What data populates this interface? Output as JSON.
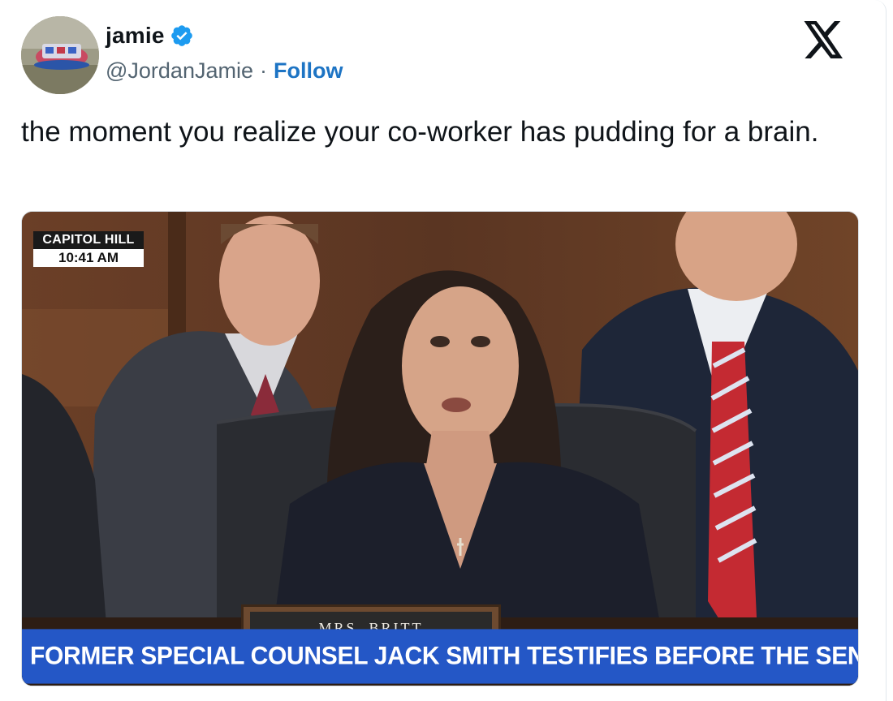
{
  "author": {
    "name": "jamie",
    "handle": "@JordanJamie",
    "separator": "·",
    "follow_label": "Follow",
    "verified_icon": "verified-badge-icon",
    "verified_color": "#1d9bf0",
    "follow_color": "#1d74c4"
  },
  "platform_icon": "x-logo-icon",
  "tweet": {
    "text": "the moment you realize your co-worker has pudding for a brain."
  },
  "media": {
    "bug_location": "CAPITOL HILL",
    "bug_time": "10:41 AM",
    "nameplate": "MRS. BRITT",
    "chyron": "FORMER SPECIAL COUNSEL JACK SMITH TESTIFIES BEFORE THE SENATE",
    "chyron_color": "#2457c6"
  }
}
